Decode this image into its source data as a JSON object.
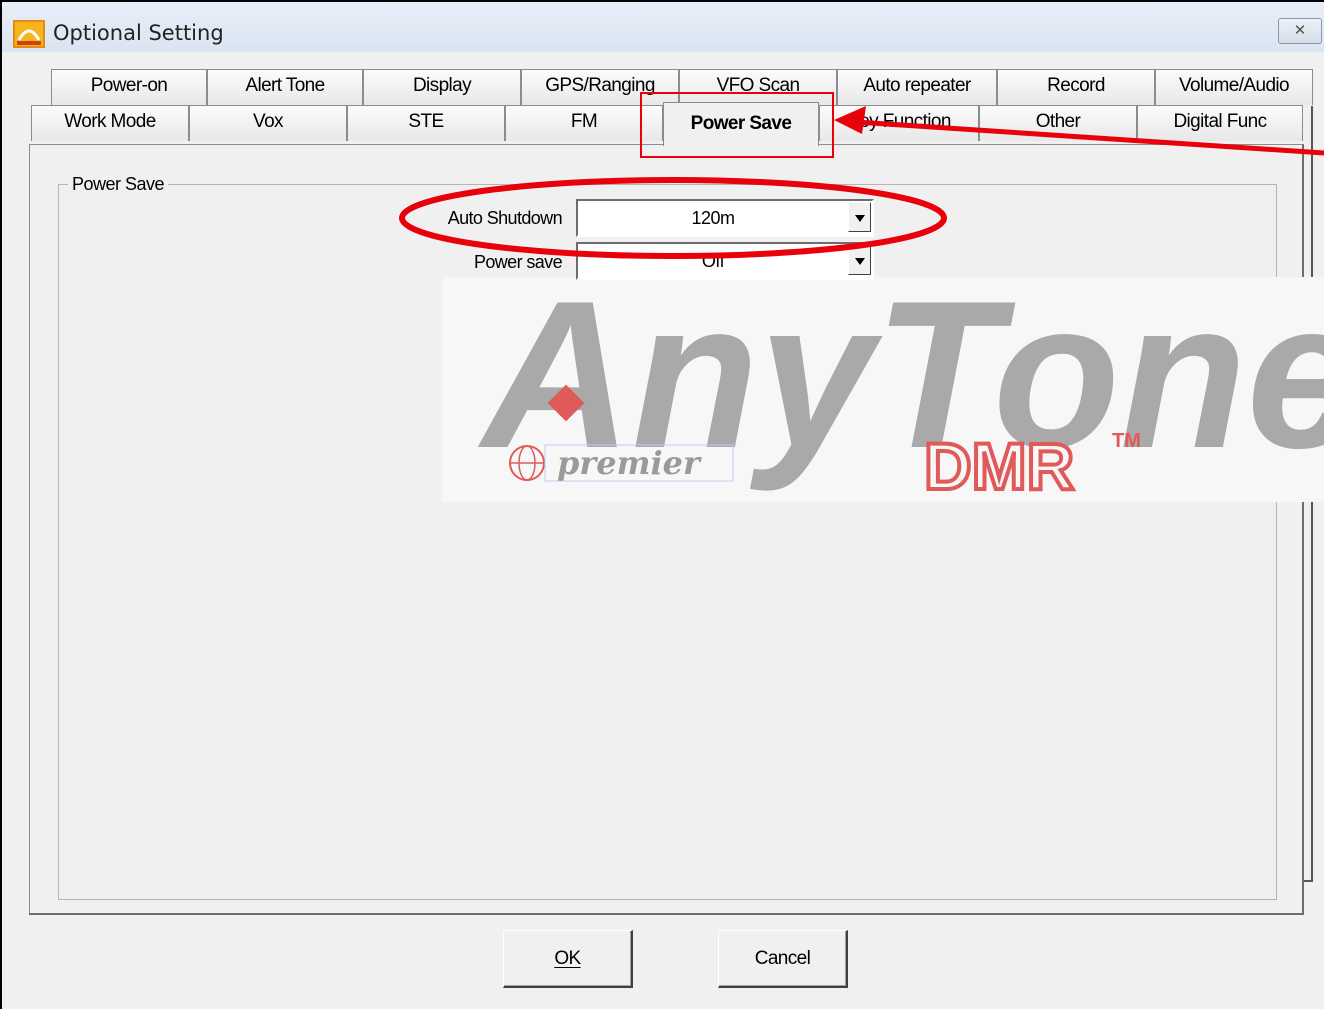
{
  "window": {
    "title": "Optional Setting",
    "close_glyph": "✕"
  },
  "tabs_row1": [
    "Power-on",
    "Alert Tone",
    "Display",
    "GPS/Ranging",
    "VFO Scan",
    "Auto repeater",
    "Record",
    "Volume/Audio"
  ],
  "tabs_row2": [
    "Work Mode",
    "Vox",
    "STE",
    "FM",
    "Power Save",
    "Key Function",
    "Other",
    "Digital Func"
  ],
  "active_tab": "Power Save",
  "group": {
    "title": "Power Save"
  },
  "fields": {
    "auto_shutdown": {
      "label": "Auto Shutdown",
      "value": "120m"
    },
    "power_save": {
      "label": "Power save",
      "value": "Off"
    }
  },
  "buttons": {
    "ok": "OK",
    "cancel": "Cancel"
  },
  "watermark": {
    "brand": "AnyTone",
    "sub": "DMR",
    "tm": "TM",
    "premier": "premier"
  },
  "colors": {
    "annotation": "#e8000a",
    "logo_grey": "#a9a9a9",
    "logo_red": "#e05a5a"
  },
  "icons": {
    "app": "app-icon",
    "close": "close-icon",
    "dropdown": "chevron-down-icon",
    "globe": "globe-icon"
  }
}
